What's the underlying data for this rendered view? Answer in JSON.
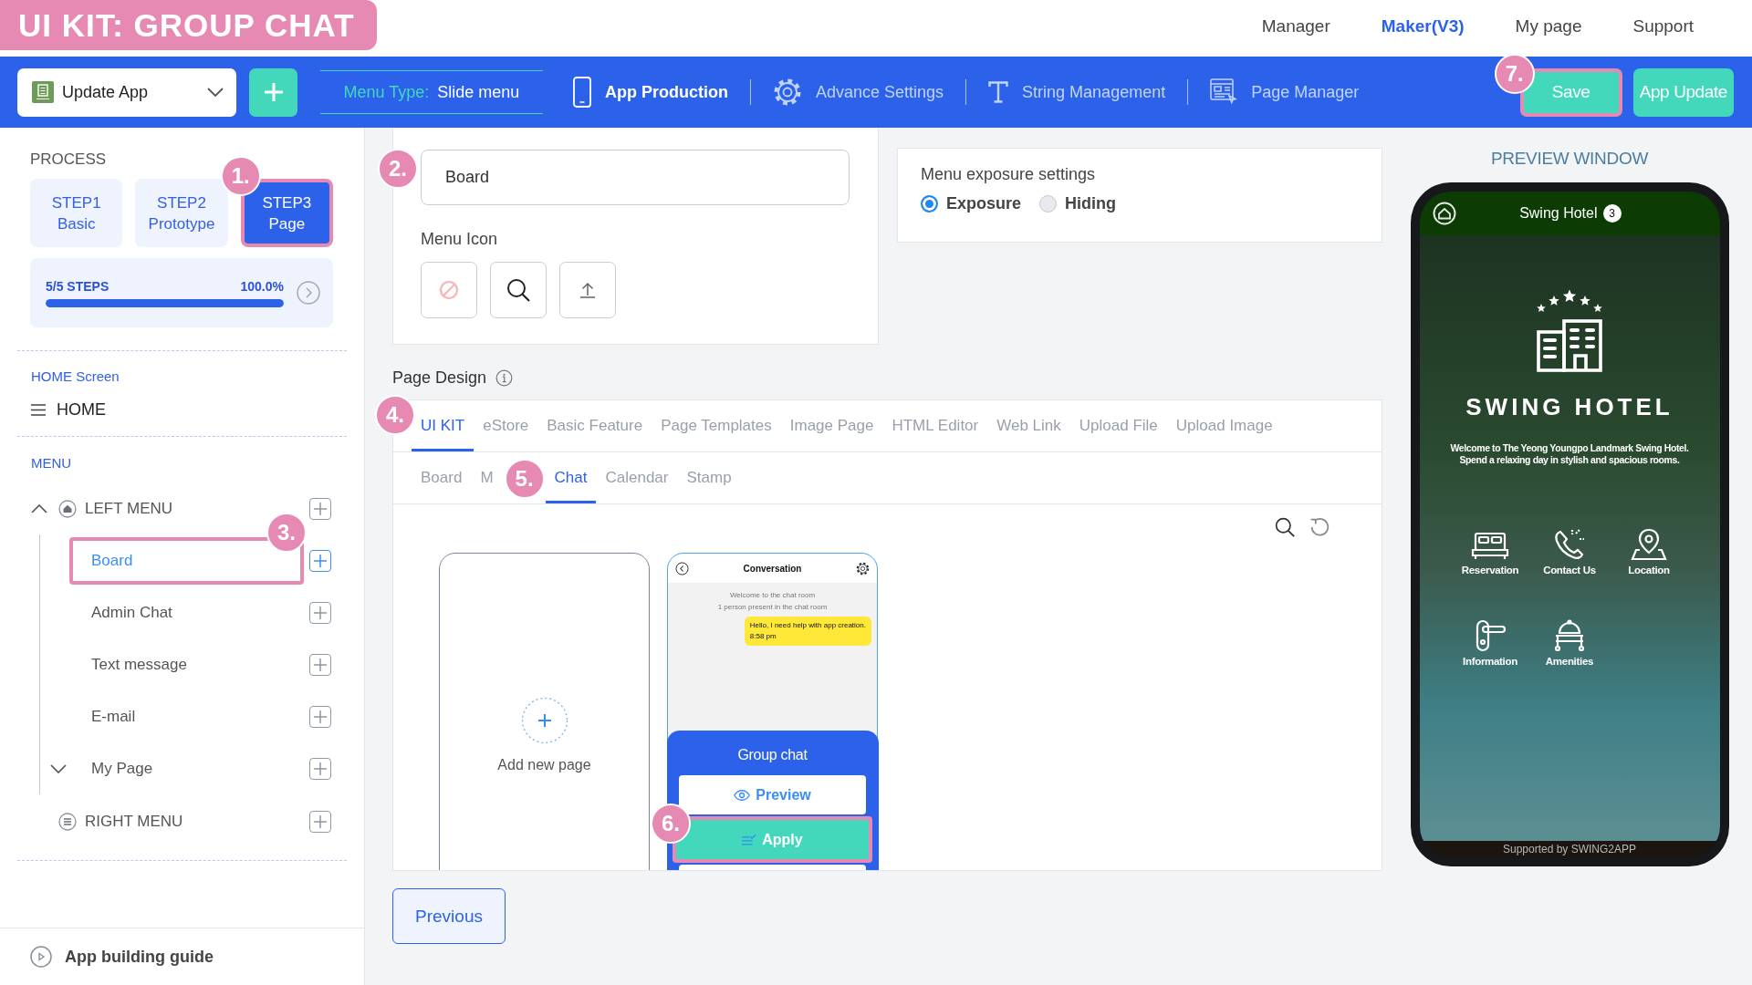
{
  "banner": {
    "title": "UI KIT: GROUP CHAT"
  },
  "top_nav": [
    {
      "label": "Manager",
      "selected": false
    },
    {
      "label": "Maker(V3)",
      "selected": true
    },
    {
      "label": "My page",
      "selected": false
    },
    {
      "label": "Support",
      "selected": false
    }
  ],
  "toolbar": {
    "app_select": {
      "value": "Update App"
    },
    "menu_type": {
      "label": "Menu Type:",
      "value": "Slide menu"
    },
    "nav": [
      {
        "label": "App Production",
        "kind": "phone",
        "selected": true
      },
      {
        "label": "Advance Settings",
        "kind": "gear",
        "selected": false
      },
      {
        "label": "String Management",
        "kind": "text",
        "selected": false
      },
      {
        "label": "Page Manager",
        "kind": "page",
        "selected": false
      }
    ],
    "buttons": [
      {
        "label": "Save",
        "kind": "save",
        "callout": {
          "label": "7.",
          "outline": true
        }
      },
      {
        "label": "App Update",
        "kind": "update"
      }
    ]
  },
  "sidebar": {
    "process": {
      "title": "PROCESS",
      "steps": [
        {
          "label": "STEP1",
          "sublabel": "Basic",
          "selected": false
        },
        {
          "label": "STEP2",
          "sublabel": "Prototype",
          "selected": false
        },
        {
          "label": "STEP3",
          "sublabel": "Page",
          "selected": true,
          "callout": {
            "label": "1.",
            "outline": true
          }
        }
      ],
      "progress": {
        "label": "5/5 STEPS",
        "reading": "100.0%",
        "level": 1.0
      }
    },
    "home": {
      "title": "HOME Screen",
      "item": "HOME"
    },
    "menu": {
      "title": "MENU",
      "groups": [
        {
          "label": "LEFT MENU",
          "kind": "home",
          "expanded": true,
          "children": [
            {
              "label": "Board",
              "selected": true,
              "callout": {
                "label": "3.",
                "outline": true
              }
            },
            {
              "label": "Admin Chat",
              "selected": false
            },
            {
              "label": "Text message",
              "selected": false
            },
            {
              "label": "E-mail",
              "selected": false
            },
            {
              "label": "My Page",
              "selected": false,
              "expanded": false
            }
          ]
        },
        {
          "label": "RIGHT MENU",
          "kind": "list"
        }
      ]
    },
    "guide": "App building guide"
  },
  "main": {
    "menu_name": {
      "value": "Board",
      "callout": {
        "label": "2.",
        "outline": false
      }
    },
    "menu_icon": {
      "title": "Menu Icon",
      "options": [
        {
          "kind": "none"
        },
        {
          "kind": "search"
        },
        {
          "kind": "upload"
        }
      ]
    },
    "exposure": {
      "title": "Menu exposure settings",
      "options": [
        {
          "label": "Exposure",
          "selected": true
        },
        {
          "label": "Hiding",
          "selected": false
        }
      ]
    },
    "page_design": {
      "title": "Page Design",
      "tabs": [
        {
          "label": "UI KIT",
          "selected": true,
          "callout": {
            "label": "4.",
            "outline": false
          }
        },
        {
          "label": "eStore",
          "selected": false
        },
        {
          "label": "Basic Feature",
          "selected": false
        },
        {
          "label": "Page Templates",
          "selected": false
        },
        {
          "label": "Image Page",
          "selected": false
        },
        {
          "label": "HTML Editor",
          "selected": false
        },
        {
          "label": "Web Link",
          "selected": false
        },
        {
          "label": "Upload File",
          "selected": false
        },
        {
          "label": "Upload Image",
          "selected": false
        }
      ],
      "subtabs": [
        {
          "label": "Board",
          "selected": false
        },
        {
          "label": "M",
          "selected": false
        },
        {
          "label": "Chat",
          "selected": true,
          "callout": {
            "label": "5.",
            "outline": false
          }
        },
        {
          "label": "Calendar",
          "selected": false
        },
        {
          "label": "Stamp",
          "selected": false
        }
      ],
      "pages": [
        {
          "kind": "add",
          "label": "Add new page"
        },
        {
          "kind": "template",
          "screen": {
            "title": "Conversation",
            "notices": [
              "Welcome to the chat room",
              "1 person present in the chat room"
            ],
            "message": {
              "text": "Hello, I need help with app creation.",
              "time": "8:58 pm"
            }
          },
          "name": "Group chat",
          "actions": [
            {
              "kind": "preview",
              "label": "Preview"
            },
            {
              "kind": "apply",
              "label": "Apply",
              "callout": {
                "label": "6.",
                "outline": true
              }
            },
            {
              "kind": "blank"
            }
          ]
        }
      ]
    },
    "previous": "Previous"
  },
  "preview": {
    "title": "PREVIEW WINDOW",
    "app": {
      "title": "Swing Hotel",
      "badge": "3",
      "name": "SWING HOTEL",
      "welcome": [
        "Welcome to The Yeong Youngpo Landmark Swing Hotel.",
        "Spend a relaxing day in stylish and spacious rooms."
      ],
      "menu": [
        {
          "label": "Reservation",
          "kind": "bed"
        },
        {
          "label": "Contact Us",
          "kind": "phone"
        },
        {
          "label": "Location",
          "kind": "pin"
        },
        {
          "label": "Information",
          "kind": "door"
        },
        {
          "label": "Amenities",
          "kind": "cart"
        }
      ],
      "footer": "Supported by SWING2APP"
    }
  }
}
